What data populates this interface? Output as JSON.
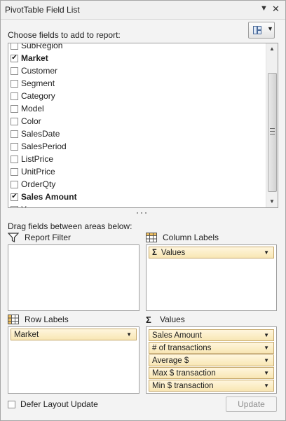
{
  "title": "PivotTable Field List",
  "choose_text": "Choose fields to add to report:",
  "fields": [
    {
      "label": "SubRegion",
      "checked": false
    },
    {
      "label": "Market",
      "checked": true
    },
    {
      "label": "Customer",
      "checked": false
    },
    {
      "label": "Segment",
      "checked": false
    },
    {
      "label": "Category",
      "checked": false
    },
    {
      "label": "Model",
      "checked": false
    },
    {
      "label": "Color",
      "checked": false
    },
    {
      "label": "SalesDate",
      "checked": false
    },
    {
      "label": "SalesPeriod",
      "checked": false
    },
    {
      "label": "ListPrice",
      "checked": false
    },
    {
      "label": "UnitPrice",
      "checked": false
    },
    {
      "label": "OrderQty",
      "checked": false
    },
    {
      "label": "Sales Amount",
      "checked": true
    },
    {
      "label": "Years",
      "checked": false
    }
  ],
  "drag_text": "Drag fields between areas below:",
  "areas": {
    "report_filter": {
      "title": "Report Filter"
    },
    "column_labels": {
      "title": "Column Labels",
      "items": [
        "Values"
      ]
    },
    "row_labels": {
      "title": "Row Labels",
      "items": [
        "Market"
      ]
    },
    "values": {
      "title": "Values",
      "items": [
        "Sales Amount",
        "# of transactions",
        "Average $",
        "Max $ transaction",
        "Min $ transaction"
      ]
    }
  },
  "defer_label": "Defer Layout Update",
  "update_label": "Update"
}
